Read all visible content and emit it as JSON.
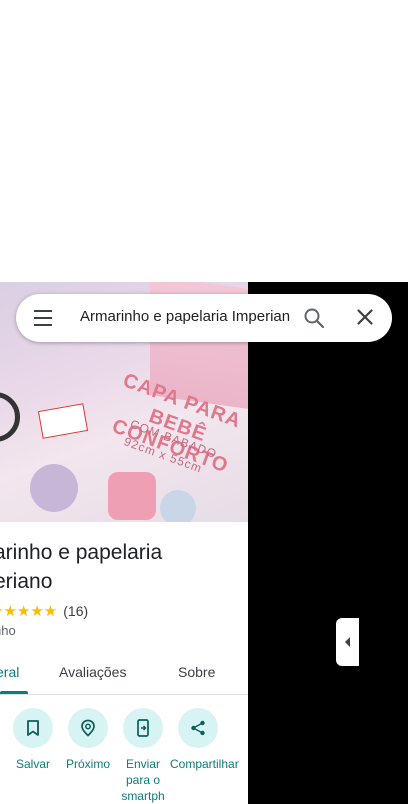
{
  "search": {
    "query": "Armarinho e papelaria Imperiano"
  },
  "photo": {
    "text_line1": "CAPA PARA",
    "text_line2": "BEBÊ CONFORTO",
    "text_line3": "COM BABADO",
    "text_line4": "92cm x 55cm"
  },
  "place": {
    "name_line1": "arinho e papelaria",
    "name_line2": "eriano",
    "stars": "★★★★★",
    "reviews": "(16)",
    "category": "nho"
  },
  "tabs": [
    {
      "label": "eral"
    },
    {
      "label": "Avaliações"
    },
    {
      "label": "Sobre"
    }
  ],
  "actions": [
    {
      "label": "Salvar"
    },
    {
      "label": "Próximo"
    },
    {
      "label": "Enviar para o smartph"
    },
    {
      "label": "Compartilhar"
    }
  ],
  "colors": {
    "accent": "#0b7c7a",
    "action_bg": "#d8f3f4",
    "star": "#fbbc04"
  }
}
